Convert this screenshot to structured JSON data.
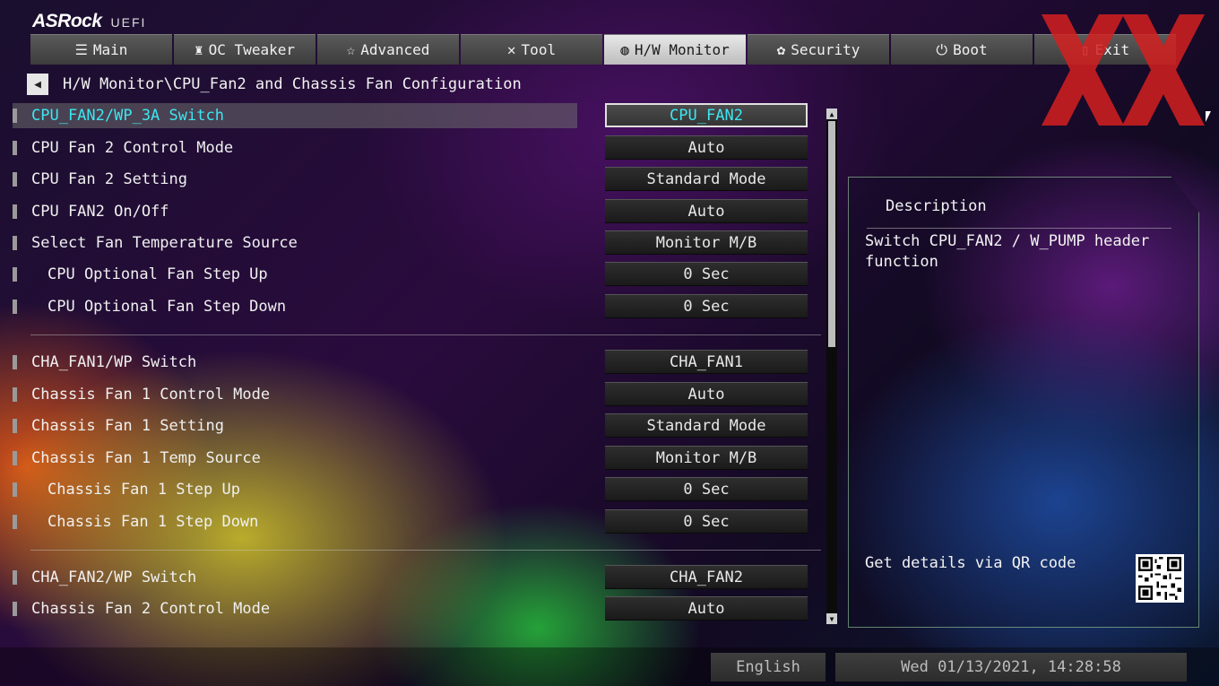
{
  "brand": {
    "name": "ASRock",
    "suffix": "UEFI"
  },
  "tabs": [
    {
      "label": "Main",
      "icon": "list-icon",
      "glyph": "☰",
      "active": false
    },
    {
      "label": "OC Tweaker",
      "icon": "rocket-icon",
      "glyph": "♜",
      "active": false
    },
    {
      "label": "Advanced",
      "icon": "star-icon",
      "glyph": "☆",
      "active": false
    },
    {
      "label": "Tool",
      "icon": "tools-icon",
      "glyph": "✕",
      "active": false
    },
    {
      "label": "H/W Monitor",
      "icon": "monitor-icon",
      "glyph": "◍",
      "active": true
    },
    {
      "label": "Security",
      "icon": "shield-icon",
      "glyph": "✿",
      "active": false
    },
    {
      "label": "Boot",
      "icon": "power-icon",
      "glyph": "⏻",
      "active": false
    },
    {
      "label": "Exit",
      "icon": "exit-icon",
      "glyph": "▯",
      "active": false
    }
  ],
  "breadcrumb": "H/W Monitor\\CPU_Fan2 and Chassis Fan Configuration",
  "settings": [
    {
      "label": "CPU_FAN2/WP_3A Switch",
      "value": "CPU_FAN2",
      "selected": true,
      "sub": false
    },
    {
      "label": "CPU Fan 2 Control Mode",
      "value": "Auto",
      "selected": false,
      "sub": false
    },
    {
      "label": "CPU Fan 2 Setting",
      "value": "Standard Mode",
      "selected": false,
      "sub": false
    },
    {
      "label": "CPU FAN2 On/Off",
      "value": "Auto",
      "selected": false,
      "sub": false
    },
    {
      "label": "Select Fan Temperature Source",
      "value": "Monitor M/B",
      "selected": false,
      "sub": false
    },
    {
      "label": "CPU Optional Fan Step Up",
      "value": "0 Sec",
      "selected": false,
      "sub": true
    },
    {
      "label": "CPU Optional Fan Step Down",
      "value": "0 Sec",
      "selected": false,
      "sub": true
    },
    {
      "label": "CHA_FAN1/WP Switch",
      "value": "CHA_FAN1",
      "selected": false,
      "sub": false
    },
    {
      "label": "Chassis Fan 1 Control Mode",
      "value": "Auto",
      "selected": false,
      "sub": false
    },
    {
      "label": "Chassis Fan 1 Setting",
      "value": "Standard Mode",
      "selected": false,
      "sub": false
    },
    {
      "label": "Chassis Fan 1 Temp Source",
      "value": "Monitor M/B",
      "selected": false,
      "sub": false
    },
    {
      "label": "Chassis Fan 1 Step Up",
      "value": "0 Sec",
      "selected": false,
      "sub": true
    },
    {
      "label": "Chassis Fan 1 Step Down",
      "value": "0 Sec",
      "selected": false,
      "sub": true
    },
    {
      "label": "CHA_FAN2/WP Switch",
      "value": "CHA_FAN2",
      "selected": false,
      "sub": false
    },
    {
      "label": "Chassis Fan 2 Control Mode",
      "value": "Auto",
      "selected": false,
      "sub": false
    }
  ],
  "description": {
    "title": "Description",
    "text": "Switch CPU_FAN2 / W_PUMP header function",
    "qr_label": "Get details via QR code"
  },
  "footer": {
    "language": "English",
    "datetime": "Wed 01/13/2021, 14:28:58"
  },
  "colors": {
    "selected_text": "#3ce6f0",
    "watermark_red": "#d42020"
  }
}
